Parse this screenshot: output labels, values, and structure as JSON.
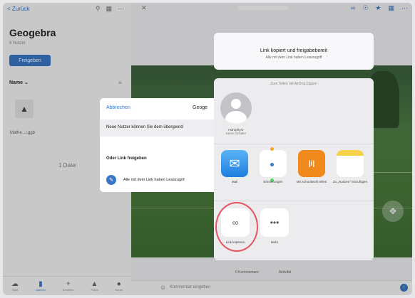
{
  "left_pane": {
    "back_label": "< Zurück",
    "title": "Geogebra",
    "subtitle": "8 Nutzer",
    "share_button": "Freigeben",
    "sort_label": "Name ⌄",
    "file_name": "Mathe...r.ggb",
    "file_count": "1 Datei",
    "tabs": [
      {
        "label": "Start",
        "icon": "cloud-icon"
      },
      {
        "label": "Dateien",
        "icon": "folder-icon",
        "active": true
      },
      {
        "label": "Erstellen",
        "icon": "plus-icon"
      },
      {
        "label": "Fotos",
        "icon": "photos-icon"
      },
      {
        "label": "Konto",
        "icon": "person-icon"
      }
    ]
  },
  "right_pane": {
    "close": "✕",
    "comments": [
      "0 Kommentare",
      "Aktivität"
    ],
    "comment_placeholder": "Kommentar eingeben"
  },
  "share_panel": {
    "cancel": "Abbrechen",
    "title": "Geoge",
    "row1": "Neue Nutzer können Sie dem übergeord",
    "section": "Oder Link freigeben",
    "link_option": "Alle mit dem Link haben Lesezugrif"
  },
  "toast": {
    "title": "Link kopiert und freigabebereit",
    "subtitle": "Alle mit dem Link haben Lesezugriff"
  },
  "share_sheet": {
    "airdrop_header": "Zum Teilen mit AirDrop tippen",
    "contact": {
      "line1": "Astrophysi-",
      "line2": "Kerns Schüler"
    },
    "apps": [
      {
        "label": "Mail"
      },
      {
        "label": "Erinnerungen"
      },
      {
        "label": "Mit Schoolwork teilen"
      },
      {
        "label": "Zu „Notizen\" hinzufügen"
      }
    ],
    "actions": [
      {
        "label": "Link kopieren"
      },
      {
        "label": "Mehr"
      }
    ]
  },
  "colors": {
    "accent": "#3a77c4",
    "highlight": "#e8535f"
  }
}
